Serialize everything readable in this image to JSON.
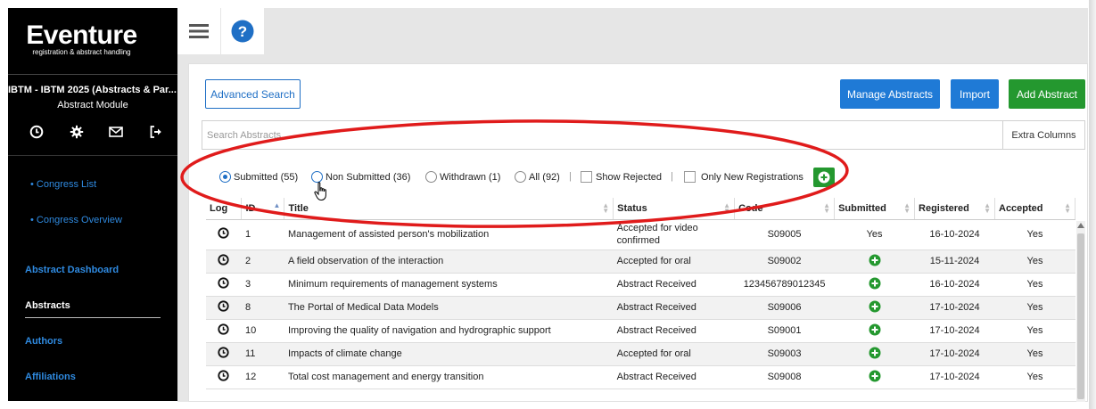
{
  "sidebar": {
    "logo_main": "Eventure",
    "logo_sub": "registration & abstract handling",
    "congress": "IBTM - IBTM 2025 (Abstracts & Par...",
    "module": "Abstract Module",
    "icons": [
      "clock-icon",
      "gear-icon",
      "mail-icon",
      "logout-icon"
    ],
    "links": {
      "congress_list": "• Congress List",
      "congress_overview": "• Congress Overview",
      "abstract_dashboard": "Abstract Dashboard",
      "abstracts": "Abstracts",
      "authors": "Authors",
      "affiliations": "Affiliations"
    }
  },
  "topbar": {
    "icons": [
      "menu-icon",
      "help-icon"
    ]
  },
  "toolbar": {
    "advanced_search": "Advanced Search",
    "manage_abstracts": "Manage Abstracts",
    "import": "Import",
    "add_abstract": "Add Abstract"
  },
  "search": {
    "placeholder": "Search Abstracts...",
    "extra_columns": "Extra Columns"
  },
  "filters": {
    "submitted": "Submitted (55)",
    "non_submitted": "Non Submitted (36)",
    "withdrawn": "Withdrawn (1)",
    "all": "All (92)",
    "show_rejected": "Show Rejected",
    "only_new": "Only New Registrations",
    "selected": "submitted"
  },
  "table": {
    "columns": [
      "Log",
      "ID",
      "Title",
      "Status",
      "Code",
      "Submitted",
      "Registered",
      "Accepted"
    ],
    "rows": [
      {
        "id": "1",
        "title": "Management of assisted person's mobilization",
        "status": "Accepted for video confirmed",
        "code": "S09005",
        "submitted": "Yes",
        "registered": "16-10-2024",
        "accepted": "Yes"
      },
      {
        "id": "2",
        "title": "A field observation of the interaction",
        "status": "Accepted for oral",
        "code": "S09002",
        "submitted": "+",
        "registered": "15-11-2024",
        "accepted": "Yes"
      },
      {
        "id": "3",
        "title": "Minimum requirements of management systems",
        "status": "Abstract Received",
        "code": "123456789012345",
        "submitted": "+",
        "registered": "16-10-2024",
        "accepted": "Yes"
      },
      {
        "id": "8",
        "title": "The Portal of Medical Data Models",
        "status": "Abstract Received",
        "code": "S09006",
        "submitted": "+",
        "registered": "17-10-2024",
        "accepted": "Yes"
      },
      {
        "id": "10",
        "title": "Improving the quality of navigation and hydrographic support",
        "status": "Abstract Received",
        "code": "S09001",
        "submitted": "+",
        "registered": "17-10-2024",
        "accepted": "Yes"
      },
      {
        "id": "11",
        "title": "Impacts of climate change",
        "status": "Accepted for oral",
        "code": "S09003",
        "submitted": "+",
        "registered": "17-10-2024",
        "accepted": "Yes"
      },
      {
        "id": "12",
        "title": "Total cost management and energy transition",
        "status": "Abstract Received",
        "code": "S09008",
        "submitted": "+",
        "registered": "17-10-2024",
        "accepted": "Yes"
      }
    ]
  },
  "colors": {
    "accent": "#1f7ad6",
    "green": "#24982f",
    "annotation": "#e01b1b"
  }
}
